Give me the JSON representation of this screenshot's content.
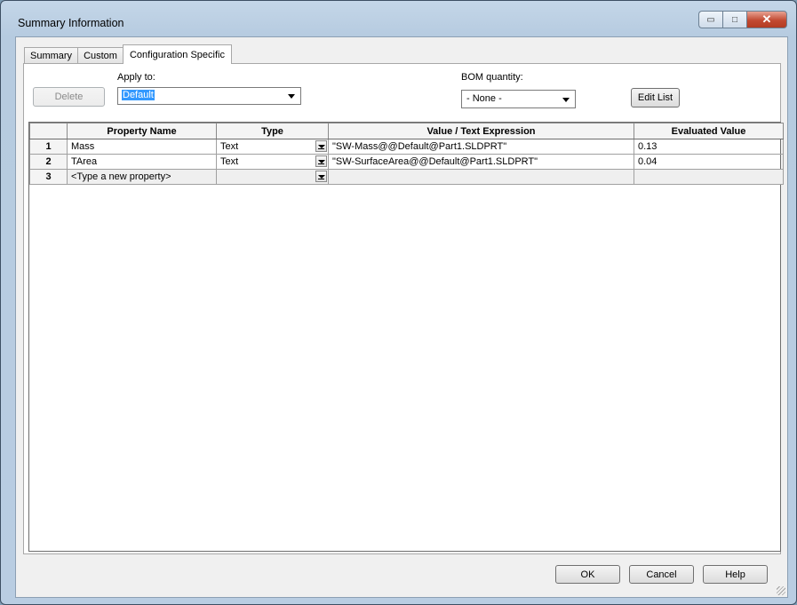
{
  "window": {
    "title": "Summary Information",
    "minimize_label": "▭",
    "maximize_label": "□",
    "close_label": "✕"
  },
  "tabs": [
    {
      "label": "Summary",
      "active": false
    },
    {
      "label": "Custom",
      "active": false
    },
    {
      "label": "Configuration Specific",
      "active": true
    }
  ],
  "controls": {
    "delete_label": "Delete",
    "apply_to_label": "Apply to:",
    "apply_to_value": "Default",
    "bom_quantity_label": "BOM quantity:",
    "bom_quantity_value": "- None -",
    "edit_list_label": "Edit List"
  },
  "table": {
    "columns": [
      "",
      "Property Name",
      "Type",
      "Value / Text Expression",
      "Evaluated Value"
    ],
    "rows": [
      {
        "num": "1",
        "name": "Mass",
        "type": "Text",
        "value": "\"SW-Mass@@Default@Part1.SLDPRT\"",
        "evaluated": "0.13"
      },
      {
        "num": "2",
        "name": "TArea",
        "type": "Text",
        "value": "\"SW-SurfaceArea@@Default@Part1.SLDPRT\"",
        "evaluated": "0.04"
      },
      {
        "num": "3",
        "name": "<Type a new property>",
        "type": "",
        "value": "",
        "evaluated": ""
      }
    ]
  },
  "footer": {
    "ok_label": "OK",
    "cancel_label": "Cancel",
    "help_label": "Help"
  }
}
